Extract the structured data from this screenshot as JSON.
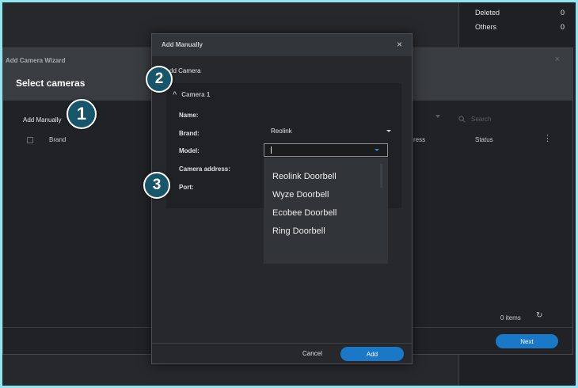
{
  "right_panel": {
    "rows": [
      {
        "label": "Deleted",
        "count": "0"
      },
      {
        "label": "Others",
        "count": "0"
      }
    ]
  },
  "wizard": {
    "title": "Add Camera Wizard",
    "heading": "Select cameras",
    "close": "×",
    "add_manually": "Add Manually",
    "columns": {
      "brand": "Brand",
      "address": "ress",
      "status": "Status"
    },
    "search_placeholder": "Search",
    "item_count": "0 items",
    "next_label": "Next"
  },
  "dialog": {
    "title": "Add Manually",
    "close": "×",
    "subtitle": "dd Camera",
    "section_title": "Camera 1",
    "fields": {
      "name": "Name:",
      "brand": "Brand:",
      "model": "Model:",
      "camera_address": "Camera address:",
      "port": "Port:"
    },
    "brand_value": "Reolink",
    "model_value": "",
    "model_options": [
      "Reolink Doorbell",
      "Wyze Doorbell",
      "Ecobee Doorbell",
      "Ring Doorbell"
    ],
    "cancel_label": "Cancel",
    "add_label": "Add"
  },
  "badges": [
    "1",
    "2",
    "3"
  ],
  "icons": {
    "close": "close-icon",
    "search": "search-icon",
    "refresh": "refresh-icon",
    "more": "more-vertical-icon",
    "chevron_up": "chevron-up-icon",
    "dropdown": "caret-down-icon"
  },
  "colors": {
    "accent": "#1b78c7",
    "badge_fill": "#17556b",
    "frame_border": "#8fe6ee"
  }
}
